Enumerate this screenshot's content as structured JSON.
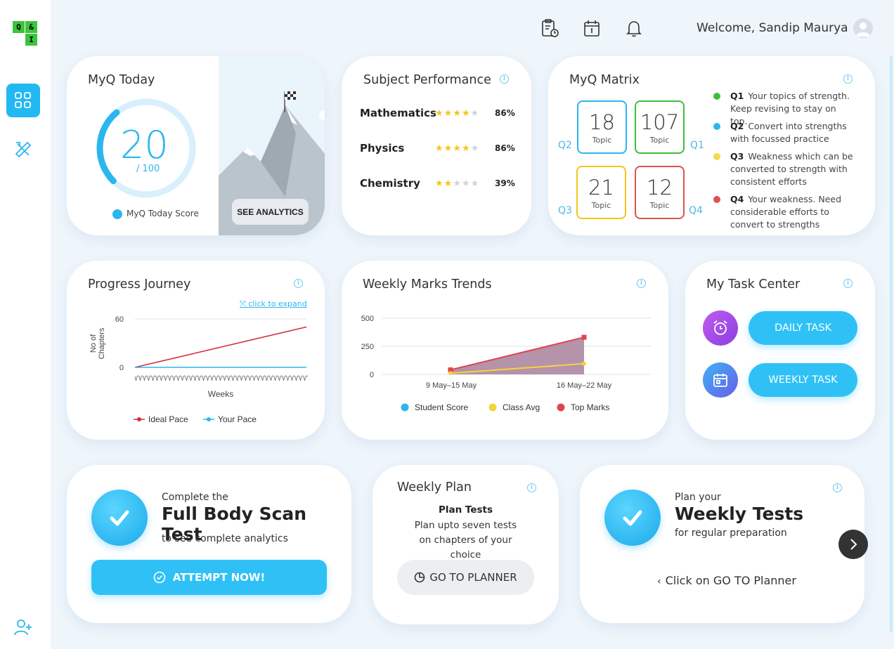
{
  "logo": {
    "letters": [
      "Q",
      "&",
      "",
      "I"
    ]
  },
  "topbar": {
    "welcome": "Welcome, Sandip Maurya"
  },
  "myq_today": {
    "title": "MyQ Today",
    "score": "20",
    "out_of": "/ 100",
    "score_value": 20,
    "legend_label": "MyQ Today Score",
    "see_analytics": "SEE ANALYTICS"
  },
  "subject_performance": {
    "title": "Subject Performance",
    "subjects": [
      {
        "name": "Mathematics",
        "stars": 4,
        "pct": "86%"
      },
      {
        "name": "Physics",
        "stars": 4,
        "pct": "86%"
      },
      {
        "name": "Chemistry",
        "stars": 2,
        "pct": "39%"
      }
    ]
  },
  "matrix": {
    "title": "MyQ Matrix",
    "boxes": [
      {
        "value": "18",
        "label": "Topic",
        "color": "#2bb6f0"
      },
      {
        "value": "107",
        "label": "Topic",
        "color": "#3cbf3c"
      },
      {
        "value": "21",
        "label": "Topic",
        "color": "#f5c518"
      },
      {
        "value": "12",
        "label": "Topic",
        "color": "#e05050"
      }
    ],
    "q_labels": [
      "Q2",
      "Q1",
      "Q3",
      "Q4"
    ],
    "legend": [
      {
        "q": "Q1",
        "text": "Your topics of strength. Keep revising to stay on top.",
        "color": "#3cbf3c"
      },
      {
        "q": "Q2",
        "text": "Convert into strengths with focussed practice",
        "color": "#2bb6f0"
      },
      {
        "q": "Q3",
        "text": "Weakness which can be converted to strength with consistent efforts",
        "color": "#f5d84a"
      },
      {
        "q": "Q4",
        "text": "Your weakness. Need considerable efforts to convert to strengths",
        "color": "#e05050"
      }
    ]
  },
  "progress": {
    "title": "Progress Journey",
    "expand": "click to expand",
    "chart_data": {
      "type": "line",
      "ylabel": "No of Chapters",
      "xlabel": "Weeks",
      "yticks": [
        "60",
        "0"
      ],
      "ylim": [
        0,
        60
      ],
      "series": [
        {
          "name": "Ideal Pace",
          "color": "#d0303c",
          "values": [
            0,
            50
          ]
        },
        {
          "name": "Your Pace",
          "color": "#2bb6f0",
          "values": [
            0,
            0
          ]
        }
      ]
    }
  },
  "weekly_marks": {
    "title": "Weekly Marks Trends",
    "chart_data": {
      "type": "area",
      "categories": [
        "9 May–15 May",
        "16 May–22 May"
      ],
      "yticks": [
        "500",
        "250",
        "0"
      ],
      "ylim": [
        0,
        500
      ],
      "series": [
        {
          "name": "Student Score",
          "color": "#2bb6f0",
          "values": [
            0,
            0
          ]
        },
        {
          "name": "Class Avg",
          "color": "#f5d43a",
          "values": [
            10,
            95
          ]
        },
        {
          "name": "Top Marks",
          "color": "#e04450",
          "values": [
            40,
            330
          ]
        }
      ]
    }
  },
  "task_center": {
    "title": "My Task Center",
    "daily": "DAILY TASK",
    "weekly": "WEEKLY TASK"
  },
  "full_scan": {
    "line1": "Complete the",
    "headline": "Full Body Scan Test",
    "line3": "to see complete analytics",
    "button": "ATTEMPT NOW!"
  },
  "weekly_plan": {
    "title": "Weekly Plan",
    "subtitle": "Plan Tests",
    "desc": "Plan upto seven tests on chapters of your choice",
    "button": "GO TO PLANNER"
  },
  "weekly_tests": {
    "line1": "Plan your",
    "headline": "Weekly Tests",
    "line3": "for regular preparation",
    "hint": "Click on GO TO Planner"
  }
}
